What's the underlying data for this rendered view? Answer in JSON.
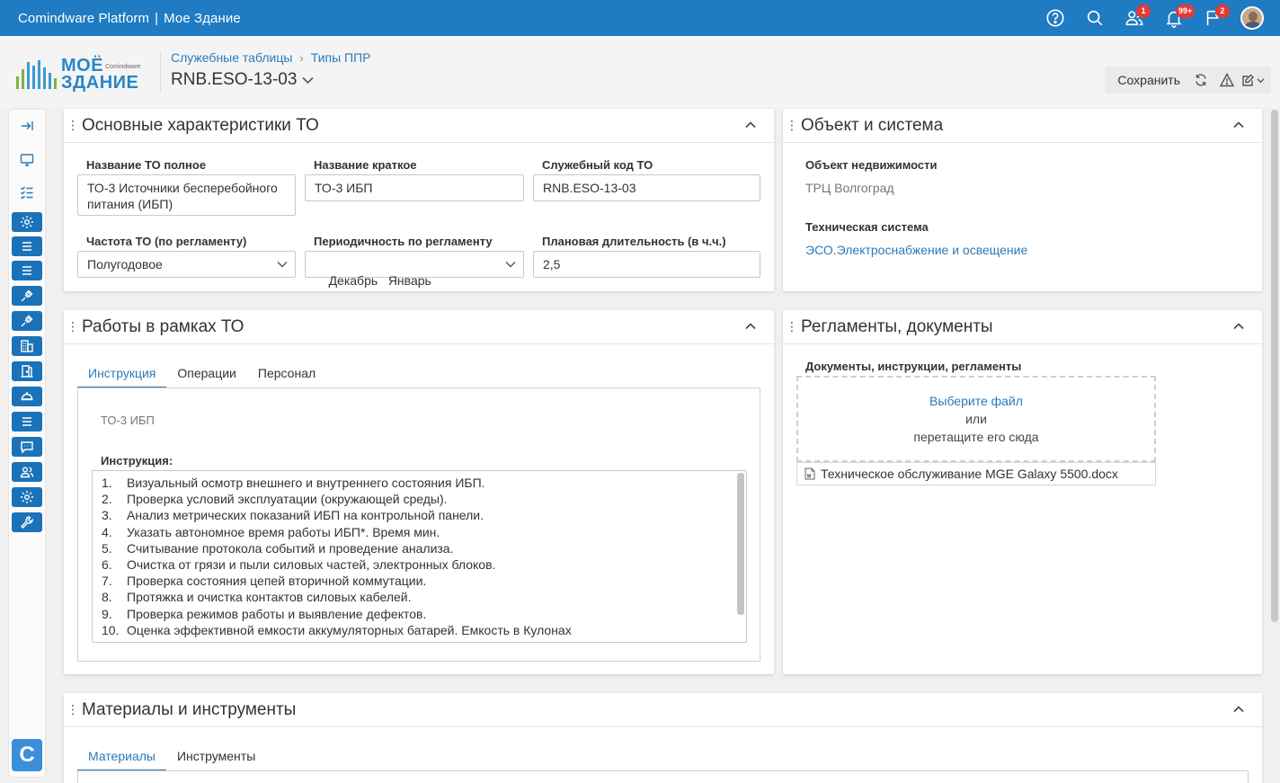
{
  "topbar": {
    "platform": "Comindware Platform",
    "separator": "|",
    "app": "Мое Здание",
    "badges": {
      "users": "1",
      "notifications": "99+",
      "flags": "2"
    }
  },
  "logo": {
    "line1": "МОЁ",
    "brand_small": "Comindware",
    "line2": "ЗДАНИЕ"
  },
  "breadcrumb": {
    "item1": "Служебные таблицы",
    "item2": "Типы ППР"
  },
  "record_title": "RNB.ESO-13-03",
  "toolbar": {
    "save_label": "Сохранить"
  },
  "panels": {
    "main": {
      "title": "Основные характеристики ТО",
      "fields": {
        "full_name": {
          "label": "Название ТО полное",
          "value": "ТО-3 Источники бесперебойного  питания (ИБП)"
        },
        "short_name": {
          "label": "Название краткое",
          "value": "ТО-3 ИБП"
        },
        "code": {
          "label": "Служебный код ТО",
          "value": "RNB.ESO-13-03"
        },
        "frequency": {
          "label": "Частота ТО (по регламенту)",
          "value": "Полугодовое"
        },
        "periodicity": {
          "label": "Периодичность по регламенту",
          "value": "Декабрь   Январь"
        },
        "duration": {
          "label": "Плановая длительность (в ч.ч.)",
          "value": "2,5"
        }
      }
    },
    "object": {
      "title": "Объект и система",
      "property_label": "Объект недвижимости",
      "property_value": "ТРЦ Волгоград",
      "system_label": "Техническая система",
      "system_value": "ЭСО.Электроснабжение и освещение"
    },
    "works": {
      "title": "Работы в рамках ТО",
      "tabs": [
        "Инструкция",
        "Операции",
        "Персонал"
      ],
      "short_name": "ТО-3 ИБП",
      "instruction_label": "Инструкция:",
      "steps": [
        {
          "n": "1.",
          "text": "Визуальный осмотр внешнего и внутреннего состояния ИБП."
        },
        {
          "n": "2.",
          "text": "Проверка условий эксплуатации (окружающей среды)."
        },
        {
          "n": "3.",
          "text": "Анализ метрических показаний ИБП на контрольной панели."
        },
        {
          "n": "4.",
          "text": "Указать автономное время работы ИБП*. Время мин."
        },
        {
          "n": "5.",
          "text": "Считывание протокола событий и проведение анализа."
        },
        {
          "n": "6.",
          "text": "Очистка от грязи и пыли силовых частей, электронных блоков."
        },
        {
          "n": "7.",
          "text": "Проверка состояния цепей вторичной коммутации."
        },
        {
          "n": "8.",
          "text": "Протяжка и очистка контактов силовых кабелей."
        },
        {
          "n": "9.",
          "text": "Проверка режимов работы и выявление дефектов."
        },
        {
          "n": "10.",
          "text": "Оценка эффективной емкости аккумуляторных батарей. Емкость в Кулонах"
        }
      ]
    },
    "docs": {
      "title": "Регламенты, документы",
      "label": "Документы, инструкции, регламенты",
      "pick": "Выберите файл",
      "or": "или",
      "drag": "перетащите его сюда",
      "file": "Техническое обслуживание MGE Galaxy 5500.docx"
    },
    "materials": {
      "title": "Материалы и инструменты",
      "tabs": [
        "Материалы",
        "Инструменты"
      ]
    }
  }
}
